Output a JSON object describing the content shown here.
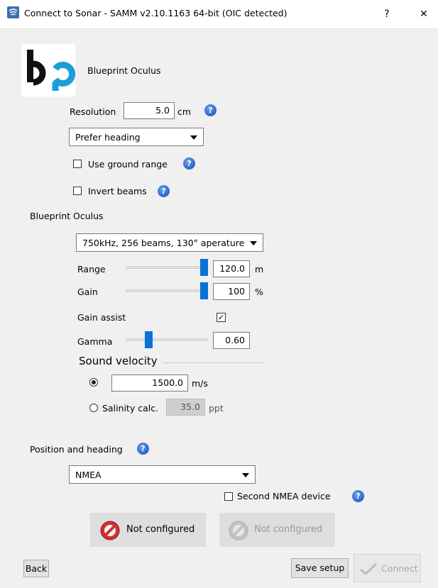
{
  "window": {
    "title": "Connect to Sonar - SAMM v2.10.1163 64-bit (OIC detected)",
    "help_glyph": "?",
    "close_glyph": "✕"
  },
  "device": {
    "logo_text": "bp",
    "name": "Blueprint Oculus"
  },
  "resolution": {
    "label": "Resolution",
    "value": "5.0",
    "unit": "cm"
  },
  "orientation_mode": {
    "selected": "Prefer heading"
  },
  "use_ground_range": {
    "label": "Use ground range",
    "checked": false
  },
  "invert_beams": {
    "label": "Invert beams",
    "checked": false
  },
  "sonar_section": {
    "title": "Blueprint Oculus",
    "frequency": {
      "selected": "750kHz, 256 beams, 130° aperature"
    },
    "range": {
      "label": "Range",
      "value": "120.0",
      "unit": "m",
      "level": 1.0
    },
    "gain": {
      "label": "Gain",
      "value": "100",
      "unit": "%",
      "level": 1.0
    },
    "gain_assist": {
      "label": "Gain assist",
      "checked": true,
      "check_glyph": "✓"
    },
    "gamma": {
      "label": "Gamma",
      "value": "0.60",
      "level": 0.25
    },
    "sound_velocity": {
      "title": "Sound velocity",
      "fixed": {
        "value": "1500.0",
        "unit": "m/s",
        "selected": true
      },
      "salinity": {
        "label": "Salinity calc.",
        "value": "35.0",
        "unit": "ppt",
        "selected": false
      }
    }
  },
  "position_heading": {
    "title": "Position and heading",
    "source": {
      "selected": "NMEA"
    },
    "second_nmea": {
      "label": "Second NMEA device",
      "checked": false
    },
    "status_primary": {
      "label": "Not configured",
      "color": "#d32f2f"
    },
    "status_secondary": {
      "label": "Not configured"
    }
  },
  "footer": {
    "back_label": "Back",
    "save_label": "Save setup",
    "connect_label": "Connect"
  },
  "colors": {
    "accent": "#0a72d4",
    "help": "#2c64c9",
    "error": "#d32f2f"
  }
}
